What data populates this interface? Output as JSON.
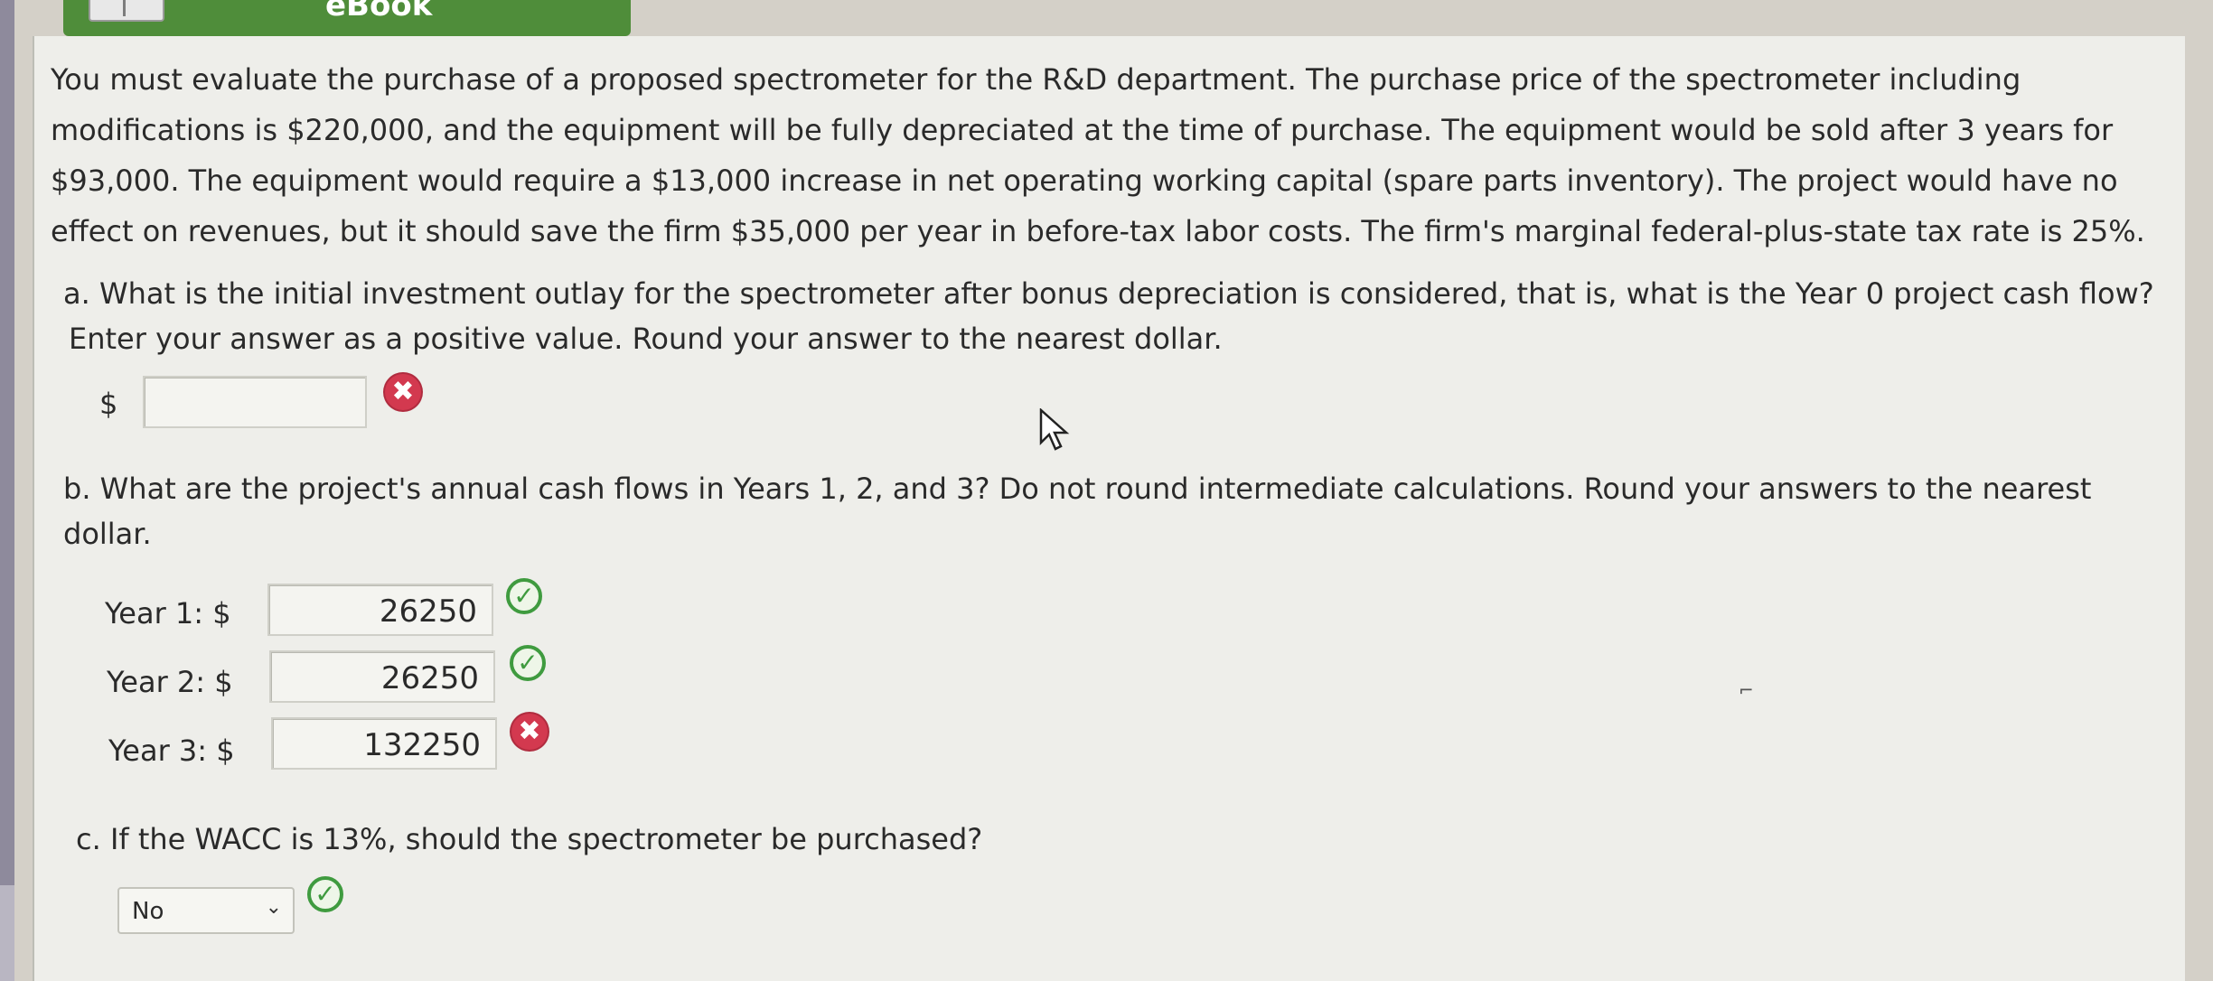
{
  "header": {
    "ebook_label": "eBook"
  },
  "problem": {
    "intro": "You must evaluate the purchase of a proposed spectrometer for the R&D department. The purchase price of the spectrometer including modifications is $220,000, and the equipment will be fully depreciated at the time of purchase. The equipment would be sold after 3 years for $93,000. The equipment would require a $13,000 increase in net operating working capital (spare parts inventory). The project would have no effect on revenues, but it should save the firm $35,000 per year in before-tax labor costs. The firm's marginal federal-plus-state tax rate is 25%."
  },
  "part_a": {
    "question": "a. What is the initial investment outlay for the spectrometer after bonus depreciation is considered, that is, what is the Year 0 project cash flow? Enter your answer as a positive value. Round your answer to the nearest dollar.",
    "currency": "$",
    "answer": "",
    "status_icon": "incorrect-x"
  },
  "part_b": {
    "question": "b. What are the project's annual cash flows in Years 1, 2, and 3? Do not round intermediate calculations. Round your answers to the nearest dollar.",
    "rows": [
      {
        "label": "Year 1: $",
        "value": "26250",
        "status": "correct-check"
      },
      {
        "label": "Year 2: $",
        "value": "26250",
        "status": "correct-check"
      },
      {
        "label": "Year 3: $",
        "value": "132250",
        "status": "incorrect-x"
      }
    ]
  },
  "part_c": {
    "question": "c. If the WACC is 13%, should the spectrometer be purchased?",
    "selected": "No",
    "status_icon": "correct-check"
  },
  "icons": {
    "incorrect_glyph": "✖",
    "correct_glyph": "✓",
    "chevron_glyph": "⌄"
  },
  "colors": {
    "incorrect": "#d3394f",
    "correct": "#3f9b3f",
    "ebook_bar": "#4f8d3a"
  }
}
